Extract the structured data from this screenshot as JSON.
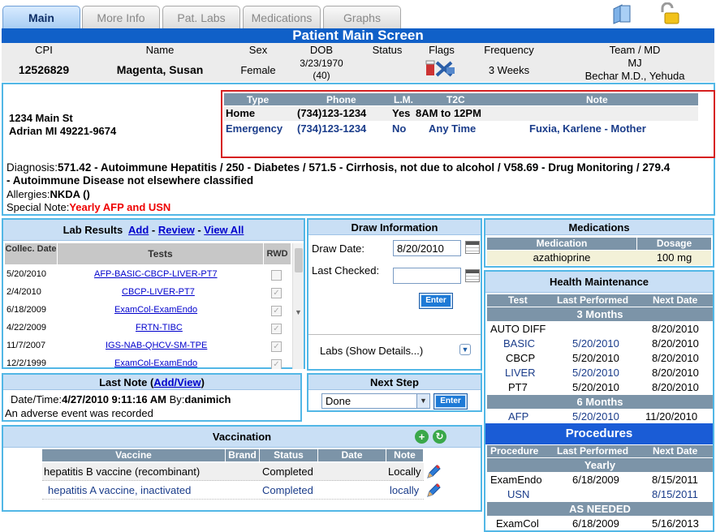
{
  "tabs": [
    "Main",
    "More Info",
    "Pat. Labs",
    "Medications",
    "Graphs"
  ],
  "icons": {
    "folder": "folder-icon",
    "lock": "lock-icon",
    "flags": "flags-icon",
    "calendar": "calendar-icon",
    "add": "add-icon",
    "refresh": "refresh-icon",
    "edit": "pencil-icon",
    "expand": "chevron-down-icon"
  },
  "title": "Patient Main Screen",
  "patient": {
    "headers": [
      "CPI",
      "Name",
      "Sex",
      "DOB",
      "Status",
      "Flags",
      "Frequency",
      "Team / MD"
    ],
    "cpi": "12526829",
    "name": "Magenta, Susan",
    "sex": "Female",
    "dob": "3/23/1970",
    "age": "(40)",
    "status": "",
    "frequency": "3 Weeks",
    "team": "MJ",
    "md": "Bechar M.D., Yehuda"
  },
  "address": {
    "line1": "1234 Main St",
    "line2": "Adrian MI 49221-9674"
  },
  "contacts": {
    "headers": [
      "Type",
      "Phone",
      "L.M.",
      "T2C",
      "Note"
    ],
    "rows": [
      {
        "type": "Home",
        "phone": "(734)123-1234",
        "lm": "Yes",
        "t2c": "8AM to 12PM",
        "note": ""
      },
      {
        "type": "Emergency",
        "phone": "(734)123-1234",
        "lm": "No",
        "t2c": "Any Time",
        "note": "Fuxia, Karlene - Mother"
      }
    ]
  },
  "diagnosis": {
    "label": "Diagnosis:",
    "text": "571.42 - Autoimmune Hepatitis / 250 - Diabetes / 571.5 - Cirrhosis, not due to alcohol / V58.69 - Drug Monitoring / 279.4 - Autoimmune Disease not elsewhere classified"
  },
  "allergies": {
    "label": "Allergies:",
    "text": "NKDA ()"
  },
  "special": {
    "label": "Special Note:",
    "text": "Yearly AFP and USN"
  },
  "labs": {
    "title": "Lab Results",
    "add": "Add",
    "review": "Review",
    "view_all": "View All",
    "sep": "-",
    "headers": [
      "Collec. Date",
      "Tests",
      "RWD"
    ],
    "rows": [
      {
        "date": "5/20/2010",
        "test": "AFP-BASIC-CBCP-LIVER-PT7",
        "rwd": false
      },
      {
        "date": "2/4/2010",
        "test": "CBCP-LIVER-PT7",
        "rwd": true
      },
      {
        "date": "6/18/2009",
        "test": "ExamCol-ExamEndo",
        "rwd": true
      },
      {
        "date": "4/22/2009",
        "test": "FRTN-TIBC",
        "rwd": true
      },
      {
        "date": "11/7/2007",
        "test": "IGS-NAB-QHCV-SM-TPE",
        "rwd": true
      },
      {
        "date": "12/2/1999",
        "test": "ExamCol-ExamEndo",
        "rwd": true
      }
    ]
  },
  "draw": {
    "title": "Draw Information",
    "draw_label": "Draw Date:",
    "draw_value": "8/20/2010",
    "last_label": "Last Checked:",
    "last_value": "",
    "enter": "Enter",
    "labs_details": "Labs (Show Details...)"
  },
  "meds": {
    "title": "Medications",
    "headers": [
      "Medication",
      "Dosage"
    ],
    "rows": [
      {
        "name": "azathioprine",
        "dose": "100 mg"
      }
    ]
  },
  "health": {
    "title": "Health Maintenance",
    "headers": [
      "Test",
      "Last Performed",
      "Next Date"
    ],
    "group1": "3 Months",
    "rows1": [
      {
        "test": "AUTO DIFF",
        "last": "",
        "next": "8/20/2010"
      },
      {
        "test": "BASIC",
        "last": "5/20/2010",
        "next": "8/20/2010"
      },
      {
        "test": "CBCP",
        "last": "5/20/2010",
        "next": "8/20/2010"
      },
      {
        "test": "LIVER",
        "last": "5/20/2010",
        "next": "8/20/2010"
      },
      {
        "test": "PT7",
        "last": "5/20/2010",
        "next": "8/20/2010"
      }
    ],
    "group2": "6 Months",
    "rows2": [
      {
        "test": "AFP",
        "last": "5/20/2010",
        "next": "11/20/2010"
      }
    ]
  },
  "procedures": {
    "title": "Procedures",
    "headers": [
      "Procedure",
      "Last Performed",
      "Next Date"
    ],
    "group1": "Yearly",
    "rows1": [
      {
        "proc": "ExamEndo",
        "last": "6/18/2009",
        "next": "8/15/2011"
      },
      {
        "proc": "USN",
        "last": "",
        "next": "8/15/2011"
      }
    ],
    "group2": "AS NEEDED",
    "rows2": [
      {
        "proc": "ExamCol",
        "last": "6/18/2009",
        "next": "5/16/2013"
      }
    ]
  },
  "last_note": {
    "title": "Last Note",
    "link": "Add/View",
    "date_label": "Date/Time:",
    "date": "4/27/2010 9:11:16 AM",
    "by_label": "By:",
    "by": "danimich",
    "text": "An adverse event was recorded"
  },
  "next_step": {
    "title": "Next Step",
    "value": "Done",
    "enter": "Enter"
  },
  "vaccination": {
    "title": "Vaccination",
    "headers": [
      "Vaccine",
      "Brand",
      "Status",
      "Date",
      "Note"
    ],
    "rows": [
      {
        "vaccine": "hepatitis B vaccine (recombinant)",
        "brand": "",
        "status": "Completed",
        "date": "",
        "note": "Locally"
      },
      {
        "vaccine": "hepatitis A vaccine, inactivated",
        "brand": "",
        "status": "Completed",
        "date": "",
        "note": "locally"
      }
    ]
  }
}
